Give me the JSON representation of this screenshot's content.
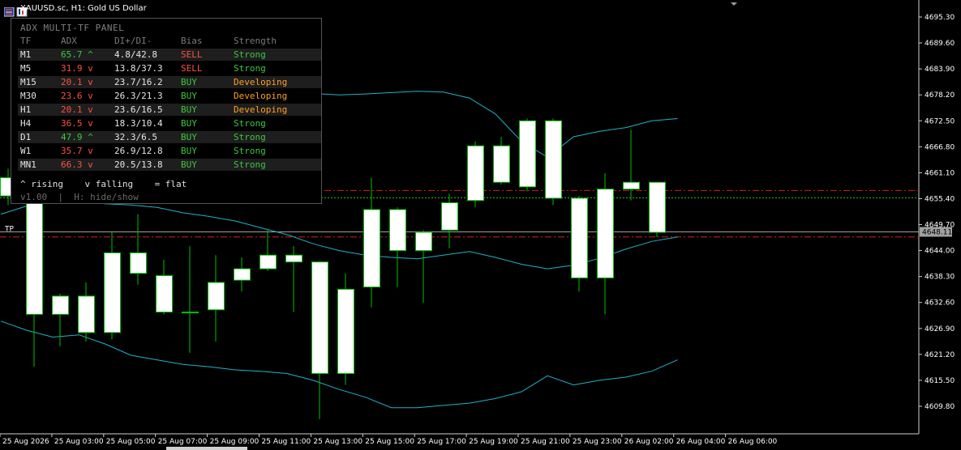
{
  "window": {
    "symbol_title": "XAUUSD.sc, H1:  Gold US Dollar"
  },
  "colors": {
    "background": "#000000",
    "bull_candle": "#ffffff",
    "candle_outline": "#00c000",
    "bollinger": "#20b2c8",
    "current_price_line": "#a0a0a0",
    "red_dashdot": "#d02020",
    "green_dotted": "#30c030",
    "green_text": "#3cc83c",
    "red_text": "#ff5040",
    "orange_text": "#ffa020"
  },
  "panel": {
    "title": "ADX MULTI-TF PANEL",
    "headers": [
      "TF",
      "ADX",
      "DI+/DI-",
      "Bias",
      "Strength"
    ],
    "rows": [
      {
        "tf": "M1",
        "adx": "65.7 ^",
        "di": "4.8/42.8",
        "bias": "SELL",
        "strength": "Strong",
        "adx_color": "green",
        "bias_color": "red",
        "strength_color": "green"
      },
      {
        "tf": "M5",
        "adx": "31.9 v",
        "di": "13.8/37.3",
        "bias": "SELL",
        "strength": "Strong",
        "adx_color": "red",
        "bias_color": "red",
        "strength_color": "green"
      },
      {
        "tf": "M15",
        "adx": "20.1 v",
        "di": "23.7/16.2",
        "bias": "BUY",
        "strength": "Developing",
        "adx_color": "red",
        "bias_color": "green",
        "strength_color": "orange"
      },
      {
        "tf": "M30",
        "adx": "23.6 v",
        "di": "26.3/21.3",
        "bias": "BUY",
        "strength": "Developing",
        "adx_color": "red",
        "bias_color": "green",
        "strength_color": "orange"
      },
      {
        "tf": "H1",
        "adx": "20.1 v",
        "di": "23.6/16.5",
        "bias": "BUY",
        "strength": "Developing",
        "adx_color": "red",
        "bias_color": "green",
        "strength_color": "orange"
      },
      {
        "tf": "H4",
        "adx": "36.5 v",
        "di": "18.3/10.4",
        "bias": "BUY",
        "strength": "Strong",
        "adx_color": "red",
        "bias_color": "green",
        "strength_color": "green"
      },
      {
        "tf": "D1",
        "adx": "47.9 ^",
        "di": "32.3/6.5",
        "bias": "BUY",
        "strength": "Strong",
        "adx_color": "green",
        "bias_color": "green",
        "strength_color": "green"
      },
      {
        "tf": "W1",
        "adx": "35.7 v",
        "di": "26.9/12.8",
        "bias": "BUY",
        "strength": "Strong",
        "adx_color": "red",
        "bias_color": "green",
        "strength_color": "green"
      },
      {
        "tf": "MN1",
        "adx": "66.3 v",
        "di": "20.5/13.8",
        "bias": "BUY",
        "strength": "Strong",
        "adx_color": "red",
        "bias_color": "green",
        "strength_color": "green"
      }
    ],
    "legend": "^ rising    v falling    = flat",
    "footer": "v1.00  |  H: hide/show"
  },
  "chart": {
    "price_ticks": [
      "4695.30",
      "4689.60",
      "4683.90",
      "4678.20",
      "4672.50",
      "4666.80",
      "4661.10",
      "4655.40",
      "4649.70",
      "4644.00",
      "4638.30",
      "4632.60",
      "4626.90",
      "4621.20",
      "4615.50",
      "4609.80"
    ],
    "current_price": "4648.11",
    "tp_label": "TP",
    "time_ticks": [
      "25 Aug 2026",
      "25 Aug 03:00",
      "25 Aug 05:00",
      "25 Aug 07:00",
      "25 Aug 09:00",
      "25 Aug 11:00",
      "25 Aug 13:00",
      "25 Aug 15:00",
      "25 Aug 17:00",
      "25 Aug 19:00",
      "25 Aug 21:00",
      "25 Aug 23:00",
      "26 Aug 02:00",
      "26 Aug 04:00",
      "26 Aug 06:00"
    ],
    "price_range": [
      4606.0,
      4698.0
    ],
    "levels": {
      "red_upper": 4657.2,
      "green_dotted": 4655.6,
      "current": 4648.11,
      "red_lower": 4647.0
    },
    "candles": [
      {
        "o": 4656.0,
        "h": 4662.0,
        "l": 4654.0,
        "c": 4660.0
      },
      {
        "o": 4630.0,
        "h": 4656.0,
        "l": 4618.5,
        "c": 4656.0
      },
      {
        "o": 4630.0,
        "h": 4634.5,
        "l": 4623.0,
        "c": 4634.0
      },
      {
        "o": 4626.0,
        "h": 4637.0,
        "l": 4624.0,
        "c": 4634.0
      },
      {
        "o": 4626.0,
        "h": 4648.0,
        "l": 4624.5,
        "c": 4643.5
      },
      {
        "o": 4643.5,
        "h": 4652.0,
        "l": 4636.5,
        "c": 4639.0
      },
      {
        "o": 4630.5,
        "h": 4642.0,
        "l": 4630.0,
        "c": 4638.5
      },
      {
        "o": 4630.5,
        "h": 4645.0,
        "l": 4621.5,
        "c": 4630.5
      },
      {
        "o": 4631.0,
        "h": 4643.0,
        "l": 4624.0,
        "c": 4637.0
      },
      {
        "o": 4637.5,
        "h": 4642.5,
        "l": 4635.0,
        "c": 4640.0
      },
      {
        "o": 4640.0,
        "h": 4648.5,
        "l": 4639.5,
        "c": 4643.0
      },
      {
        "o": 4643.0,
        "h": 4645.0,
        "l": 4630.5,
        "c": 4641.5
      },
      {
        "o": 4641.5,
        "h": 4641.5,
        "l": 4607.0,
        "c": 4617.0
      },
      {
        "o": 4617.0,
        "h": 4639.0,
        "l": 4614.5,
        "c": 4635.5
      },
      {
        "o": 4636.0,
        "h": 4660.0,
        "l": 4631.5,
        "c": 4653.0
      },
      {
        "o": 4644.0,
        "h": 4653.5,
        "l": 4636.0,
        "c": 4653.0
      },
      {
        "o": 4644.0,
        "h": 4648.5,
        "l": 4632.5,
        "c": 4648.0
      },
      {
        "o": 4648.5,
        "h": 4656.5,
        "l": 4644.5,
        "c": 4654.5
      },
      {
        "o": 4655.0,
        "h": 4668.0,
        "l": 4653.5,
        "c": 4667.0
      },
      {
        "o": 4659.0,
        "h": 4669.0,
        "l": 4658.5,
        "c": 4667.0
      },
      {
        "o": 4658.0,
        "h": 4673.0,
        "l": 4657.0,
        "c": 4672.5
      },
      {
        "o": 4672.5,
        "h": 4673.0,
        "l": 4654.0,
        "c": 4655.5
      },
      {
        "o": 4655.5,
        "h": 4656.0,
        "l": 4635.0,
        "c": 4638.0
      },
      {
        "o": 4638.0,
        "h": 4661.0,
        "l": 4630.0,
        "c": 4657.5
      },
      {
        "o": 4657.5,
        "h": 4670.5,
        "l": 4655.0,
        "c": 4659.0
      },
      {
        "o": 4648.0,
        "h": 4659.0,
        "l": 4647.0,
        "c": 4659.0
      }
    ],
    "bands": {
      "upper": [
        4658,
        4657.8,
        4658.5,
        4660.5,
        4664.5,
        4669,
        4672.5,
        4674.5,
        4676,
        4676.3,
        4676.5,
        4677.5,
        4678.5,
        4678.2,
        4678.4,
        4678.7,
        4679,
        4678.8,
        4677.5,
        4674,
        4668,
        4664.5,
        4669,
        4670.2,
        4671,
        4672.5,
        4673
      ],
      "middle": [
        4652,
        4653.8,
        4655.2,
        4654.8,
        4654.3,
        4654,
        4653.5,
        4652.3,
        4651.5,
        4650.5,
        4649,
        4647.5,
        4645.5,
        4644,
        4643,
        4642.5,
        4642.2,
        4643,
        4643.8,
        4642.5,
        4641,
        4640,
        4640.8,
        4642.3,
        4644.3,
        4646,
        4647
      ],
      "lower": [
        4628.5,
        4626.5,
        4625,
        4625.5,
        4623.5,
        4621,
        4620,
        4619,
        4618.5,
        4617.8,
        4617.5,
        4617,
        4615.5,
        4613.5,
        4611.8,
        4609.5,
        4609.5,
        4610,
        4610.5,
        4611.5,
        4613,
        4616.5,
        4614.5,
        4615.5,
        4616.2,
        4617.5,
        4620
      ]
    }
  }
}
